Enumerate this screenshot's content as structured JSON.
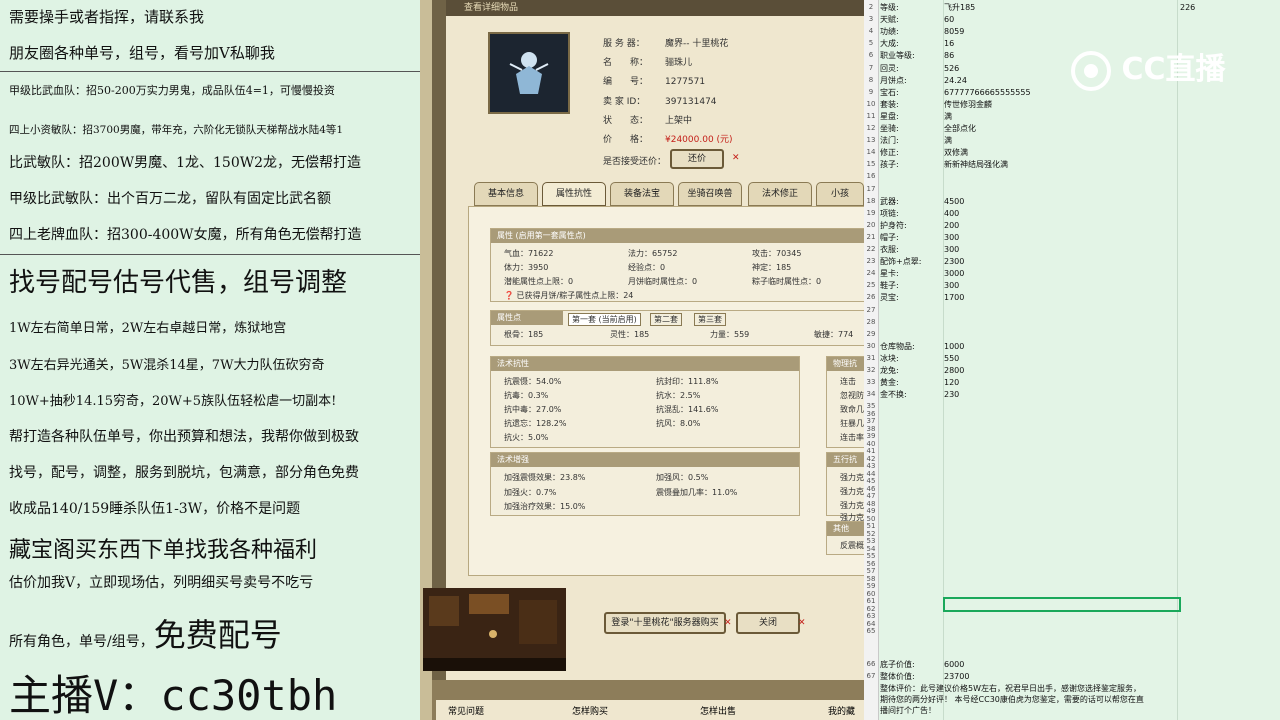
{
  "left_panel": {
    "lines": [
      "需要操手或者指挥，请联系我",
      "朋友圈各种单号，组号，看号加V私聊我",
      "甲级比武血队：招50-200万实力男鬼，成品队伍4=1，可慢慢投资",
      "四上小资敏队：招3700男魔，带年充，六阶化无锁队天梯帮战水陆4等1",
      "比武敏队：招200W男魔、1龙、150W2龙，无偿帮打造",
      "甲级比武敏队：出个百万二龙，留队有固定比武名额",
      "四上老牌血队：招300-400W女魔，所有角色无偿帮打造",
      "找号配号估号代售，组号调整",
      "1W左右简单日常，2W左右卓越日常，炼狱地宫",
      "3W左右异光通关，5W混杀14星，7W大力队伍砍穷奇",
      "10W+抽秒14.15穷奇，20W+5族队伍轻松虐一切副本!",
      "帮打造各种队伍单号，你出预算和想法，我帮你做到极致",
      "找号，配号，调整，服务到脱坑，包满意，部分角色免费",
      "收成品140/159睡杀队伍1-3W，价格不是问题",
      "藏宝阁买东西下单找我各种福利",
      "估价加我V，立即现场估，列明细买号卖号不吃亏",
      "所有角色，单号/组号，",
      "免费配号",
      "主播V：cc30tbh"
    ]
  },
  "game": {
    "window_title": "查看详细物品",
    "info": {
      "server_label": "服 务 器：",
      "server_value": "魔界-- 十里桃花",
      "name_label": "名　　称：",
      "name_value": "骊珠儿",
      "id_label": "编　　号：",
      "id_value": "1277571",
      "seller_label": "卖 家 ID：",
      "seller_value": "397131474",
      "status_label": "状　　态：",
      "status_value": "上架中",
      "price_label": "价　　格：",
      "price_value": "¥24000.00 (元)",
      "bargain_label": "是否接受还价：",
      "bargain_button": "还价"
    },
    "tabs": [
      "基本信息",
      "属性抗性",
      "装备法宝",
      "坐骑召唤兽",
      "法术修正",
      "小孩"
    ],
    "attr_panel": {
      "title": "属性 (启用第一套属性点)",
      "cells": [
        "气血：71622",
        "法力：65752",
        "攻击：70345",
        "体力：3950",
        "经验点：0",
        "神定：185",
        "潜能属性点上限：0",
        "月饼临时属性点：0",
        "粽子临时属性点：0"
      ],
      "note": "已获得月饼/粽子属性点上限：24"
    },
    "points_panel": {
      "title": "属性点",
      "subtabs": [
        "第一套 (当前启用)",
        "第二套",
        "第三套"
      ],
      "cells": [
        "根骨：185",
        "灵性：185",
        "力量：559",
        "敏捷：774"
      ]
    },
    "resist_panel": {
      "title": "法术抗性",
      "cells": [
        "抗震慑：54.0%",
        "抗封印：111.8%",
        "抗毒：0.3%",
        "抗水：2.5%",
        "抗中毒：27.0%",
        "抗混乱：141.6%",
        "抗遗忘：128.2%",
        "抗风：8.0%",
        "抗火：5.0%"
      ]
    },
    "boost_panel": {
      "title": "法术增强",
      "cells": [
        "加强震慑效果：23.8%",
        "加强风：0.5%",
        "加强火：0.7%",
        "震慑叠加几率：11.0%",
        "加强治疗效果：15.0%"
      ]
    },
    "side_panels": {
      "physical": "物理抗",
      "physical_items": [
        "连击",
        "忽视防",
        "致命几",
        "狂暴几",
        "连击率"
      ],
      "five": "五行抗",
      "five_items": [
        "强力克",
        "强力克",
        "强力克",
        "强力克"
      ],
      "other": "其他",
      "other_item": "反震概"
    },
    "bottom_buttons": [
      "登录\"十里桃花\"服务器购买",
      "关闭"
    ],
    "nav": [
      "常见问题",
      "怎样购买",
      "怎样出售",
      "我的藏"
    ]
  },
  "sheet": {
    "logo_text": "CC直播",
    "rows": [
      {
        "n": "2",
        "a": "等级:",
        "b": "飞升185",
        "c": "226"
      },
      {
        "n": "3",
        "a": "天赋:",
        "b": "60",
        "c": ""
      },
      {
        "n": "4",
        "a": "功绩:",
        "b": "8059",
        "c": ""
      },
      {
        "n": "5",
        "a": "大成:",
        "b": "16",
        "c": ""
      },
      {
        "n": "6",
        "a": "职业等级:",
        "b": "86",
        "c": ""
      },
      {
        "n": "7",
        "a": "回灵:",
        "b": "526",
        "c": ""
      },
      {
        "n": "8",
        "a": "月饼点:",
        "b": "24.24",
        "c": ""
      },
      {
        "n": "9",
        "a": "宝石:",
        "b": "67777766665555555",
        "c": ""
      },
      {
        "n": "10",
        "a": "套装:",
        "b": "传世修羽金麟",
        "c": ""
      },
      {
        "n": "11",
        "a": "星盘:",
        "b": "满",
        "c": ""
      },
      {
        "n": "12",
        "a": "坐骑:",
        "b": "全部点化",
        "c": ""
      },
      {
        "n": "13",
        "a": "法门:",
        "b": "满",
        "c": ""
      },
      {
        "n": "14",
        "a": "修正:",
        "b": "双修满",
        "c": ""
      },
      {
        "n": "15",
        "a": "孩子:",
        "b": "新新神结局强化满",
        "c": ""
      },
      {
        "n": "16",
        "a": "",
        "b": "",
        "c": ""
      },
      {
        "n": "17",
        "a": "",
        "b": "",
        "c": ""
      },
      {
        "n": "18",
        "a": "武器:",
        "b": "4500",
        "c": ""
      },
      {
        "n": "19",
        "a": "项链:",
        "b": "400",
        "c": ""
      },
      {
        "n": "20",
        "a": "护身符:",
        "b": "200",
        "c": ""
      },
      {
        "n": "21",
        "a": "帽子:",
        "b": "300",
        "c": ""
      },
      {
        "n": "22",
        "a": "衣服:",
        "b": "300",
        "c": ""
      },
      {
        "n": "23",
        "a": "配饰+点翠:",
        "b": "2300",
        "c": ""
      },
      {
        "n": "24",
        "a": "星卡:",
        "b": "3000",
        "c": ""
      },
      {
        "n": "25",
        "a": "鞋子:",
        "b": "300",
        "c": ""
      },
      {
        "n": "26",
        "a": "灵宝:",
        "b": "1700",
        "c": ""
      },
      {
        "n": "27",
        "a": "",
        "b": "",
        "c": ""
      },
      {
        "n": "28",
        "a": "",
        "b": "",
        "c": ""
      },
      {
        "n": "29",
        "a": "",
        "b": "",
        "c": ""
      },
      {
        "n": "30",
        "a": "仓库物品:",
        "b": "1000",
        "c": ""
      },
      {
        "n": "31",
        "a": "冰块:",
        "b": "550",
        "c": ""
      },
      {
        "n": "32",
        "a": "龙兔:",
        "b": "2800",
        "c": ""
      },
      {
        "n": "33",
        "a": "黄金:",
        "b": "120",
        "c": ""
      },
      {
        "n": "34",
        "a": "金不换:",
        "b": "230",
        "c": ""
      }
    ],
    "row_numbers_lower": [
      "35",
      "36",
      "37",
      "38",
      "39",
      "40",
      "41",
      "42",
      "43",
      "44",
      "45",
      "46",
      "47",
      "48",
      "49",
      "50",
      "51",
      "52",
      "53",
      "54",
      "55",
      "56",
      "57",
      "58",
      "59",
      "60",
      "61",
      "62",
      "63",
      "64",
      "65"
    ],
    "footer_rows": [
      {
        "n": "66",
        "a": "底子价值:",
        "b": "6000"
      },
      {
        "n": "67",
        "a": "整体价值:",
        "b": "23700"
      }
    ],
    "footer_text": [
      "整体评价：此号建议价格5W左右，祝君早日出手，感谢您选择鉴定服务，",
      "期待您的两分好评！ 本号经CC30康伯虎为您鉴定，需要的话可以帮您在直",
      "播间打个广告！"
    ]
  }
}
